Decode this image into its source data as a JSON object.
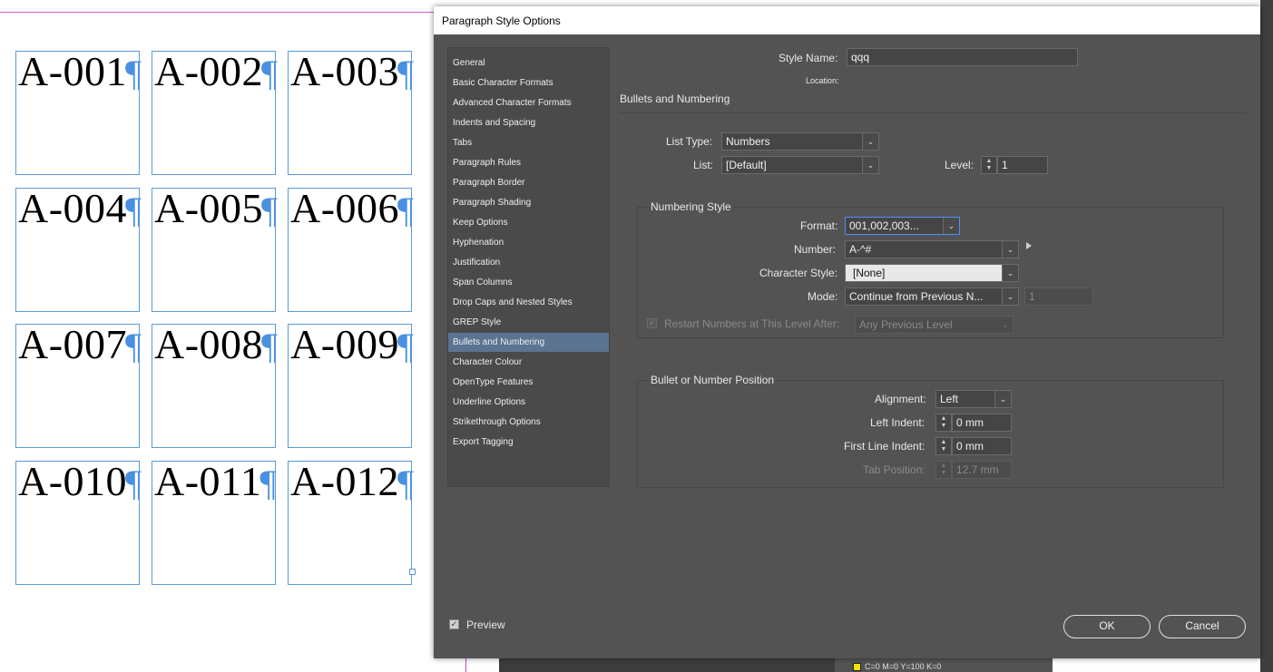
{
  "document": {
    "frames": [
      "A-001",
      "A-002",
      "A-003",
      "A-004",
      "A-005",
      "A-006",
      "A-007",
      "A-008",
      "A-009",
      "A-010",
      "A-011",
      "A-012"
    ],
    "pilcrow": "¶"
  },
  "background_app": {
    "swatch_label": "C=0 M=0 Y=100 K=0"
  },
  "dialog": {
    "title": "Paragraph Style Options",
    "categories": [
      "General",
      "Basic Character Formats",
      "Advanced Character Formats",
      "Indents and Spacing",
      "Tabs",
      "Paragraph Rules",
      "Paragraph Border",
      "Paragraph Shading",
      "Keep Options",
      "Hyphenation",
      "Justification",
      "Span Columns",
      "Drop Caps and Nested Styles",
      "GREP Style",
      "Bullets and Numbering",
      "Character Colour",
      "OpenType Features",
      "Underline Options",
      "Strikethrough Options",
      "Export Tagging"
    ],
    "selected_category": "Bullets and Numbering",
    "style_name_label": "Style Name:",
    "style_name_value": "qqq",
    "location_label": "Location:",
    "section_heading": "Bullets and Numbering",
    "list_type_label": "List Type:",
    "list_type_value": "Numbers",
    "list_label": "List:",
    "list_value": "[Default]",
    "level_label": "Level:",
    "level_value": "1",
    "numbering_style": {
      "title": "Numbering Style",
      "format_label": "Format:",
      "format_value": "001,002,003...",
      "number_label": "Number:",
      "number_value": "A-^#",
      "char_style_label": "Character Style:",
      "char_style_value": "[None]",
      "mode_label": "Mode:",
      "mode_value": "Continue from Previous N...",
      "mode_start_value": "1",
      "restart_label": "Restart Numbers at This Level After:",
      "restart_value": "Any Previous Level"
    },
    "position": {
      "title": "Bullet or Number Position",
      "alignment_label": "Alignment:",
      "alignment_value": "Left",
      "left_indent_label": "Left Indent:",
      "left_indent_value": "0 mm",
      "first_line_label": "First Line Indent:",
      "first_line_value": "0 mm",
      "tab_position_label": "Tab Position:",
      "tab_position_value": "12.7 mm"
    },
    "preview_label": "Preview",
    "ok_label": "OK",
    "cancel_label": "Cancel"
  }
}
